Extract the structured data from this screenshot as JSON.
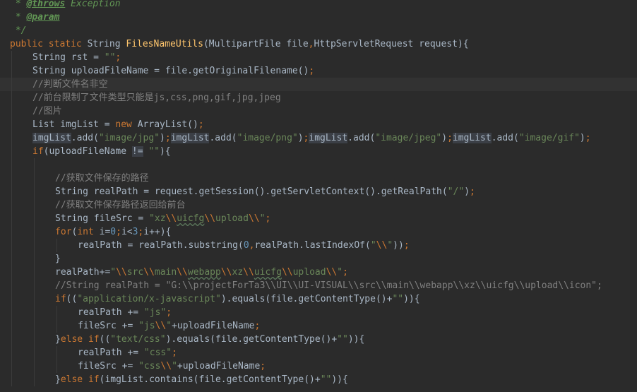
{
  "editor": {
    "colors": {
      "background": "#2b2b2b",
      "current_line": "#323232",
      "keyword": "#cc7832",
      "string": "#6a8759",
      "comment": "#808080",
      "doc_comment": "#629755",
      "number": "#6897bb",
      "method_declaration": "#ffc66d",
      "identifier": "#a9b7c6",
      "usage_highlight": "#3b3f46"
    },
    "lines": [
      {
        "indent": 0,
        "tokens": [
          {
            "t": " * ",
            "c": "doc"
          },
          {
            "t": "@throws",
            "c": "tag"
          },
          {
            "t": " Exception",
            "c": "doc"
          }
        ]
      },
      {
        "indent": 0,
        "tokens": [
          {
            "t": " * ",
            "c": "doc"
          },
          {
            "t": "@param",
            "c": "tag"
          }
        ]
      },
      {
        "indent": 0,
        "tokens": [
          {
            "t": " */",
            "c": "doc"
          }
        ]
      },
      {
        "indent": 0,
        "tokens": [
          {
            "t": "public static ",
            "c": "kw"
          },
          {
            "t": "String ",
            "c": "plain"
          },
          {
            "t": "FilesNameUtils",
            "c": "fn"
          },
          {
            "t": "(MultipartFile file",
            "c": "plain"
          },
          {
            "t": ",",
            "c": "kw"
          },
          {
            "t": "HttpServletRequest request){",
            "c": "plain"
          }
        ]
      },
      {
        "indent": 1,
        "tokens": [
          {
            "t": "String rst = ",
            "c": "plain"
          },
          {
            "t": "\"\"",
            "c": "str"
          },
          {
            "t": ";",
            "c": "kw"
          }
        ]
      },
      {
        "indent": 1,
        "tokens": [
          {
            "t": "String uploadFileName = file.getOriginalFilename()",
            "c": "plain"
          },
          {
            "t": ";",
            "c": "kw"
          }
        ]
      },
      {
        "indent": 1,
        "current": true,
        "tokens": [
          {
            "t": "//判断文件名非空",
            "c": "cmt"
          }
        ]
      },
      {
        "indent": 1,
        "tokens": [
          {
            "t": "//前台限制了文件类型只能是js,css,png,gif,jpg,jpeg",
            "c": "cmt"
          }
        ]
      },
      {
        "indent": 1,
        "tokens": [
          {
            "t": "//图片",
            "c": "cmt"
          }
        ]
      },
      {
        "indent": 1,
        "tokens": [
          {
            "t": "List imgList = ",
            "c": "plain"
          },
          {
            "t": "new ",
            "c": "kw"
          },
          {
            "t": "ArrayList()",
            "c": "plain"
          },
          {
            "t": ";",
            "c": "kw"
          }
        ]
      },
      {
        "indent": 1,
        "tokens": [
          {
            "t": "imgList",
            "c": "plain",
            "hl": true
          },
          {
            "t": ".add(",
            "c": "plain"
          },
          {
            "t": "\"image/jpg\"",
            "c": "str"
          },
          {
            "t": ")",
            "c": "plain"
          },
          {
            "t": ";",
            "c": "kw"
          },
          {
            "t": "imgList",
            "c": "plain",
            "hl": true
          },
          {
            "t": ".add(",
            "c": "plain"
          },
          {
            "t": "\"image/png\"",
            "c": "str"
          },
          {
            "t": ")",
            "c": "plain"
          },
          {
            "t": ";",
            "c": "kw"
          },
          {
            "t": "imgList",
            "c": "plain",
            "hl": true
          },
          {
            "t": ".add(",
            "c": "plain"
          },
          {
            "t": "\"image/jpeg\"",
            "c": "str"
          },
          {
            "t": ")",
            "c": "plain"
          },
          {
            "t": ";",
            "c": "kw"
          },
          {
            "t": "imgList",
            "c": "plain",
            "hl": true
          },
          {
            "t": ".add(",
            "c": "plain"
          },
          {
            "t": "\"image/gif\"",
            "c": "str"
          },
          {
            "t": ")",
            "c": "plain"
          },
          {
            "t": ";",
            "c": "kw"
          }
        ]
      },
      {
        "indent": 1,
        "tokens": [
          {
            "t": "if",
            "c": "kw"
          },
          {
            "t": "(uploadFileName ",
            "c": "plain"
          },
          {
            "t": "!=",
            "c": "plain",
            "hl": true
          },
          {
            "t": " ",
            "c": "plain"
          },
          {
            "t": "\"\"",
            "c": "str"
          },
          {
            "t": "){",
            "c": "plain"
          }
        ]
      },
      {
        "indent": 2,
        "tokens": []
      },
      {
        "indent": 2,
        "tokens": [
          {
            "t": "//获取文件保存的路径",
            "c": "cmt"
          }
        ]
      },
      {
        "indent": 2,
        "tokens": [
          {
            "t": "String realPath = request.getSession().getServletContext().getRealPath(",
            "c": "plain"
          },
          {
            "t": "\"/\"",
            "c": "str"
          },
          {
            "t": ")",
            "c": "plain"
          },
          {
            "t": ";",
            "c": "kw"
          }
        ]
      },
      {
        "indent": 2,
        "tokens": [
          {
            "t": "//获取文件保存路径返回给前台",
            "c": "cmt"
          }
        ]
      },
      {
        "indent": 2,
        "tokens": [
          {
            "t": "String fileSrc = ",
            "c": "plain"
          },
          {
            "t": "\"xz",
            "c": "str"
          },
          {
            "t": "\\\\",
            "c": "kw"
          },
          {
            "t": "uicfg",
            "c": "str",
            "typo": true
          },
          {
            "t": "\\\\",
            "c": "kw"
          },
          {
            "t": "upload",
            "c": "str"
          },
          {
            "t": "\\\\",
            "c": "kw"
          },
          {
            "t": "\"",
            "c": "str"
          },
          {
            "t": ";",
            "c": "kw"
          }
        ]
      },
      {
        "indent": 2,
        "tokens": [
          {
            "t": "for",
            "c": "kw"
          },
          {
            "t": "(",
            "c": "plain"
          },
          {
            "t": "int ",
            "c": "kw"
          },
          {
            "t": "i=",
            "c": "plain"
          },
          {
            "t": "0",
            "c": "num"
          },
          {
            "t": ";",
            "c": "kw"
          },
          {
            "t": "i<",
            "c": "plain"
          },
          {
            "t": "3",
            "c": "num"
          },
          {
            "t": ";",
            "c": "kw"
          },
          {
            "t": "i++){",
            "c": "plain"
          }
        ]
      },
      {
        "indent": 3,
        "tokens": [
          {
            "t": "realPath = realPath.substring(",
            "c": "plain"
          },
          {
            "t": "0",
            "c": "num"
          },
          {
            "t": ",",
            "c": "kw"
          },
          {
            "t": "realPath.lastIndexOf(",
            "c": "plain"
          },
          {
            "t": "\"",
            "c": "str"
          },
          {
            "t": "\\\\",
            "c": "kw"
          },
          {
            "t": "\"",
            "c": "str"
          },
          {
            "t": "))",
            "c": "plain"
          },
          {
            "t": ";",
            "c": "kw"
          }
        ]
      },
      {
        "indent": 2,
        "tokens": [
          {
            "t": "}",
            "c": "plain"
          }
        ]
      },
      {
        "indent": 2,
        "tokens": [
          {
            "t": "realPath+=",
            "c": "plain"
          },
          {
            "t": "\"",
            "c": "str"
          },
          {
            "t": "\\\\",
            "c": "kw"
          },
          {
            "t": "src",
            "c": "str"
          },
          {
            "t": "\\\\",
            "c": "kw"
          },
          {
            "t": "main",
            "c": "str"
          },
          {
            "t": "\\\\",
            "c": "kw"
          },
          {
            "t": "webapp",
            "c": "str",
            "typo": true
          },
          {
            "t": "\\\\",
            "c": "kw"
          },
          {
            "t": "xz",
            "c": "str"
          },
          {
            "t": "\\\\",
            "c": "kw"
          },
          {
            "t": "uicfg",
            "c": "str",
            "typo": true
          },
          {
            "t": "\\\\",
            "c": "kw"
          },
          {
            "t": "upload",
            "c": "str"
          },
          {
            "t": "\\\\",
            "c": "kw"
          },
          {
            "t": "\"",
            "c": "str"
          },
          {
            "t": ";",
            "c": "kw"
          }
        ]
      },
      {
        "indent": 2,
        "tokens": [
          {
            "t": "//String realPath = \"G:\\\\projectForTa3\\\\UI\\\\UI-VISUAL\\\\src\\\\main\\\\webapp\\\\xz\\\\uicfg\\\\upload\\\\icon\";",
            "c": "cmt"
          }
        ]
      },
      {
        "indent": 2,
        "tokens": [
          {
            "t": "if",
            "c": "kw"
          },
          {
            "t": "((",
            "c": "plain"
          },
          {
            "t": "\"application/x-javascript\"",
            "c": "str"
          },
          {
            "t": ").equals(file.getContentType()+",
            "c": "plain"
          },
          {
            "t": "\"\"",
            "c": "str"
          },
          {
            "t": ")){",
            "c": "plain"
          }
        ]
      },
      {
        "indent": 3,
        "tokens": [
          {
            "t": "realPath += ",
            "c": "plain"
          },
          {
            "t": "\"js\"",
            "c": "str"
          },
          {
            "t": ";",
            "c": "kw"
          }
        ]
      },
      {
        "indent": 3,
        "tokens": [
          {
            "t": "fileSrc += ",
            "c": "plain"
          },
          {
            "t": "\"js",
            "c": "str"
          },
          {
            "t": "\\\\",
            "c": "kw"
          },
          {
            "t": "\"",
            "c": "str"
          },
          {
            "t": "+uploadFileName",
            "c": "plain"
          },
          {
            "t": ";",
            "c": "kw"
          }
        ]
      },
      {
        "indent": 2,
        "tokens": [
          {
            "t": "}",
            "c": "plain"
          },
          {
            "t": "else if",
            "c": "kw"
          },
          {
            "t": "((",
            "c": "plain"
          },
          {
            "t": "\"text/css\"",
            "c": "str"
          },
          {
            "t": ").equals(file.getContentType()+",
            "c": "plain"
          },
          {
            "t": "\"\"",
            "c": "str"
          },
          {
            "t": ")){",
            "c": "plain"
          }
        ]
      },
      {
        "indent": 3,
        "tokens": [
          {
            "t": "realPath += ",
            "c": "plain"
          },
          {
            "t": "\"css\"",
            "c": "str"
          },
          {
            "t": ";",
            "c": "kw"
          }
        ]
      },
      {
        "indent": 3,
        "tokens": [
          {
            "t": "fileSrc += ",
            "c": "plain"
          },
          {
            "t": "\"css",
            "c": "str"
          },
          {
            "t": "\\\\",
            "c": "kw"
          },
          {
            "t": "\"",
            "c": "str"
          },
          {
            "t": "+uploadFileName",
            "c": "plain"
          },
          {
            "t": ";",
            "c": "kw"
          }
        ]
      },
      {
        "indent": 2,
        "tokens": [
          {
            "t": "}",
            "c": "plain"
          },
          {
            "t": "else if",
            "c": "kw"
          },
          {
            "t": "(imgList.contains(file.getContentType()+",
            "c": "plain"
          },
          {
            "t": "\"\"",
            "c": "str"
          },
          {
            "t": ")){",
            "c": "plain"
          }
        ]
      }
    ]
  }
}
